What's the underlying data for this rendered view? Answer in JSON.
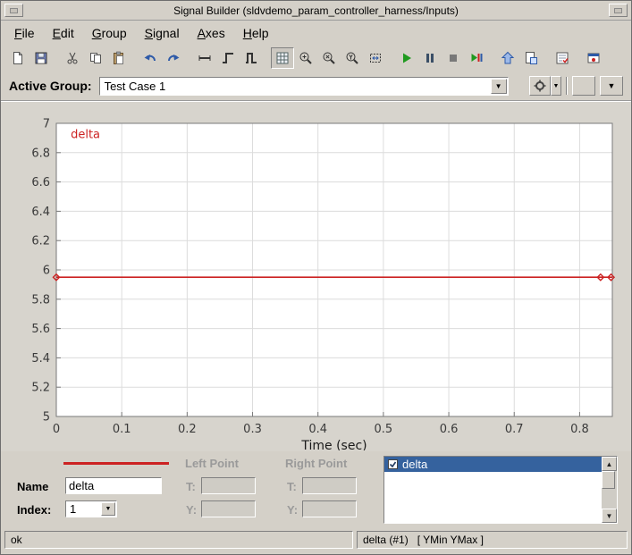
{
  "window": {
    "title": "Signal Builder (sldvdemo_param_controller_harness/Inputs)"
  },
  "menu": {
    "items": [
      {
        "label": "File"
      },
      {
        "label": "Edit"
      },
      {
        "label": "Group"
      },
      {
        "label": "Signal"
      },
      {
        "label": "Axes"
      },
      {
        "label": "Help"
      }
    ]
  },
  "toolbar": {
    "icons": [
      "new",
      "save",
      "cut",
      "copy",
      "paste",
      "undo",
      "redo",
      "line-segment",
      "step-signal",
      "pulse-signal",
      "snap-grid",
      "zoom-in",
      "zoom-x",
      "zoom-y",
      "fit-view",
      "run",
      "pause",
      "stop",
      "run-all",
      "raise-group",
      "copy-figure",
      "requirements",
      "highlight-model"
    ]
  },
  "active_group": {
    "label": "Active Group:",
    "value": "Test Case 1"
  },
  "chart_data": {
    "type": "line",
    "title": "",
    "xlabel": "Time (sec)",
    "ylabel": "",
    "xlim": [
      0,
      0.85
    ],
    "ylim": [
      5,
      7
    ],
    "xticks": [
      0,
      0.1,
      0.2,
      0.3,
      0.4,
      0.5,
      0.6,
      0.7,
      0.8
    ],
    "yticks": [
      5,
      5.2,
      5.4,
      5.6,
      5.8,
      6,
      6.2,
      6.4,
      6.6,
      6.8,
      7
    ],
    "grid": true,
    "legend_position": "none",
    "series": [
      {
        "name": "delta",
        "color": "#cc2222",
        "x": [
          0,
          0.85
        ],
        "y": [
          5.95,
          5.95
        ],
        "marker_points": [
          [
            0,
            5.95
          ],
          [
            0.832,
            5.95
          ],
          [
            0.848,
            5.95
          ]
        ]
      }
    ],
    "annotations": [
      {
        "text": "delta",
        "x": 0.022,
        "y": 6.9,
        "color": "#cc2222"
      }
    ]
  },
  "editor": {
    "left_point_label": "Left Point",
    "right_point_label": "Right Point",
    "name_label": "Name",
    "name_value": "delta",
    "index_label": "Index:",
    "index_value": "1",
    "t_label": "T:",
    "y_label": "Y:"
  },
  "signal_list": {
    "items": [
      {
        "label": "delta",
        "checked": true,
        "selected": true
      }
    ]
  },
  "status": {
    "left": "ok",
    "right": "delta (#1)   [ YMin YMax ]"
  }
}
